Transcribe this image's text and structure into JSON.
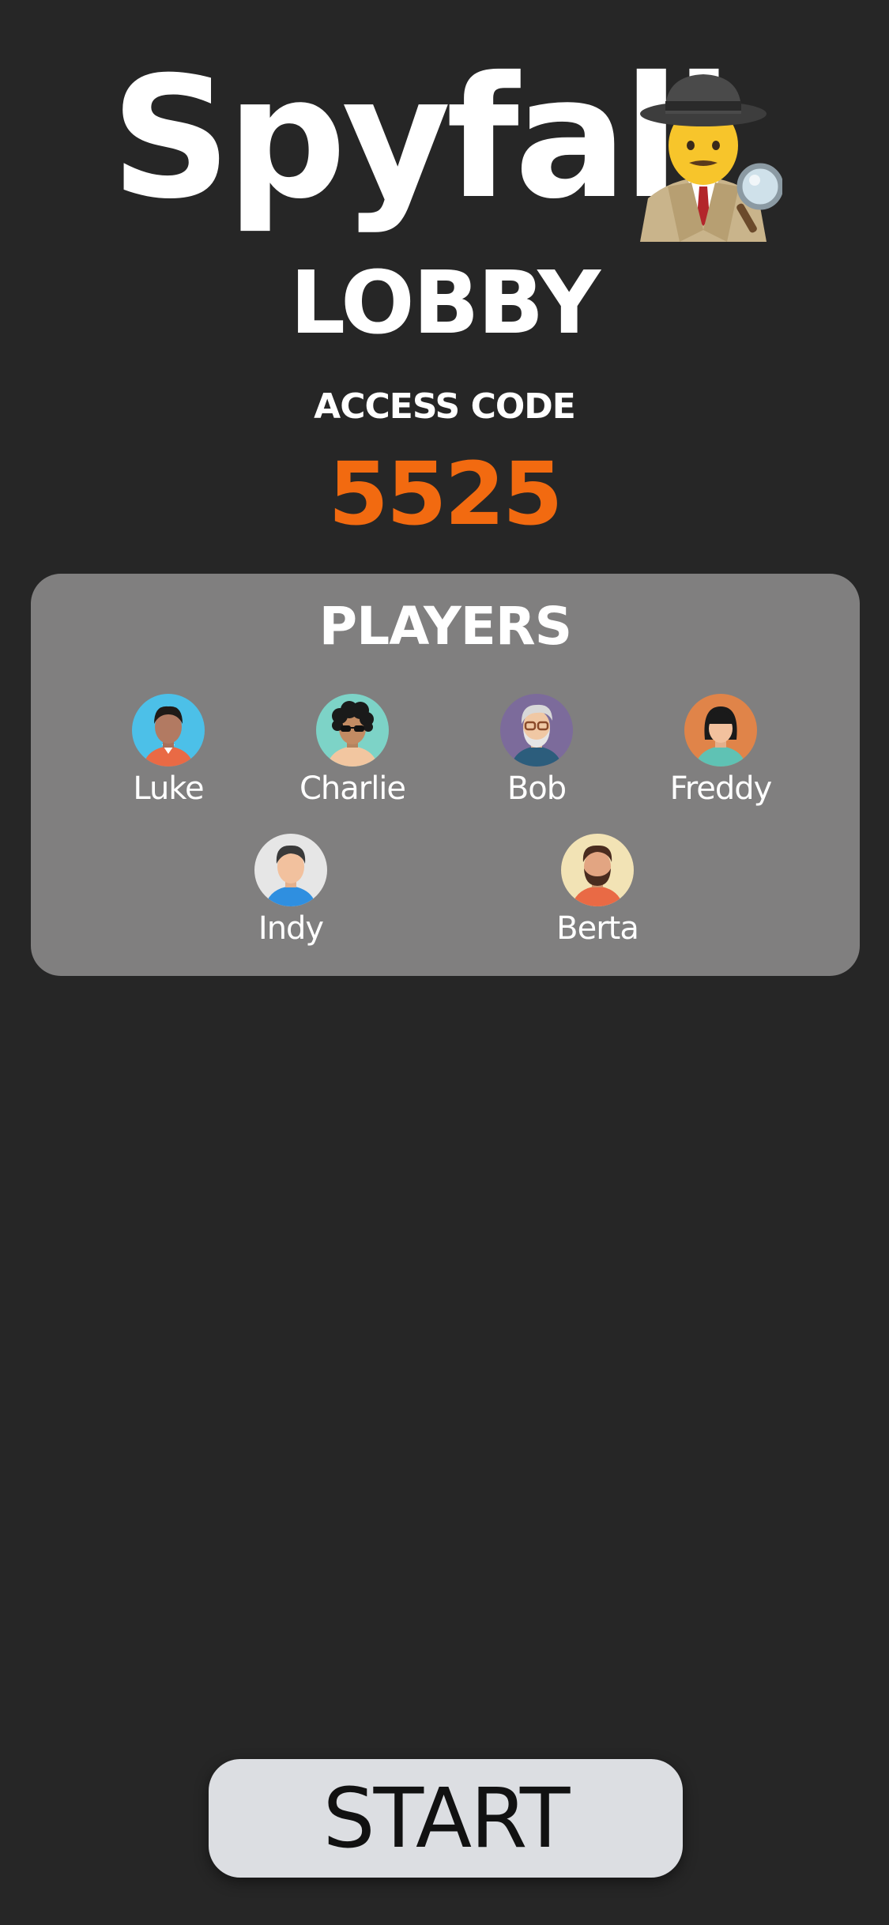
{
  "app": {
    "title": "Spyfall",
    "title_icon": "detective-emoji"
  },
  "lobby": {
    "title": "LOBBY",
    "access_code_label": "ACCESS CODE",
    "access_code": "5525",
    "access_code_color": "#f26a10"
  },
  "players": {
    "title": "PLAYERS",
    "list": [
      {
        "name": "Luke",
        "avatar": "avatar-man-short-hair",
        "bg": "#4cc0e8"
      },
      {
        "name": "Charlie",
        "avatar": "avatar-curly-hair-sunglasses",
        "bg": "#7dd3c7"
      },
      {
        "name": "Bob",
        "avatar": "avatar-old-man-glasses",
        "bg": "#7c6b9b"
      },
      {
        "name": "Freddy",
        "avatar": "avatar-woman-bob-hair",
        "bg": "#e08449"
      },
      {
        "name": "Indy",
        "avatar": "avatar-man-dark-hair",
        "bg": "#e6e6e6"
      },
      {
        "name": "Berta",
        "avatar": "avatar-bearded-man",
        "bg": "#f2e3b5"
      }
    ]
  },
  "actions": {
    "start_label": "START"
  },
  "colors": {
    "background": "#262626",
    "panel": "#807f7f",
    "button": "#dcdee2"
  }
}
